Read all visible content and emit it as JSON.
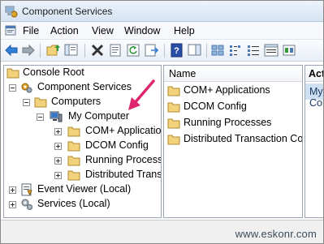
{
  "window": {
    "title": "Component Services"
  },
  "menu": {
    "items": [
      "File",
      "Action",
      "View",
      "Window",
      "Help"
    ]
  },
  "toolbar": {
    "buttons": [
      "back-icon",
      "forward-icon",
      "up-folder-icon",
      "show-tree-icon",
      "delete-icon",
      "properties-icon",
      "refresh-icon",
      "export-icon",
      "help-icon",
      "view-icon",
      "view-large-icon",
      "view-small-icon",
      "view-list-icon",
      "view-detail-icon",
      "extra-icon"
    ]
  },
  "tree": {
    "items": [
      {
        "label": "Console Root"
      },
      {
        "label": "Component Services"
      },
      {
        "label": "Computers"
      },
      {
        "label": "My Computer"
      },
      {
        "label": "COM+ Applications"
      },
      {
        "label": "DCOM Config"
      },
      {
        "label": "Running Processes"
      },
      {
        "label": "Distributed Transaction Coordinator"
      },
      {
        "label": "Event Viewer (Local)"
      },
      {
        "label": "Services (Local)"
      }
    ]
  },
  "list": {
    "header": "Name",
    "items": [
      "COM+ Applications",
      "DCOM Config",
      "Running Processes",
      "Distributed Transaction Coordinator"
    ]
  },
  "actions": {
    "header": "Actions",
    "selected": "My Computer"
  },
  "watermark": "www.eskonr.com",
  "colors": {
    "folder": "#f2d27a",
    "selection": "#cfe0f3",
    "annotation_arrow": "#e0266e"
  }
}
